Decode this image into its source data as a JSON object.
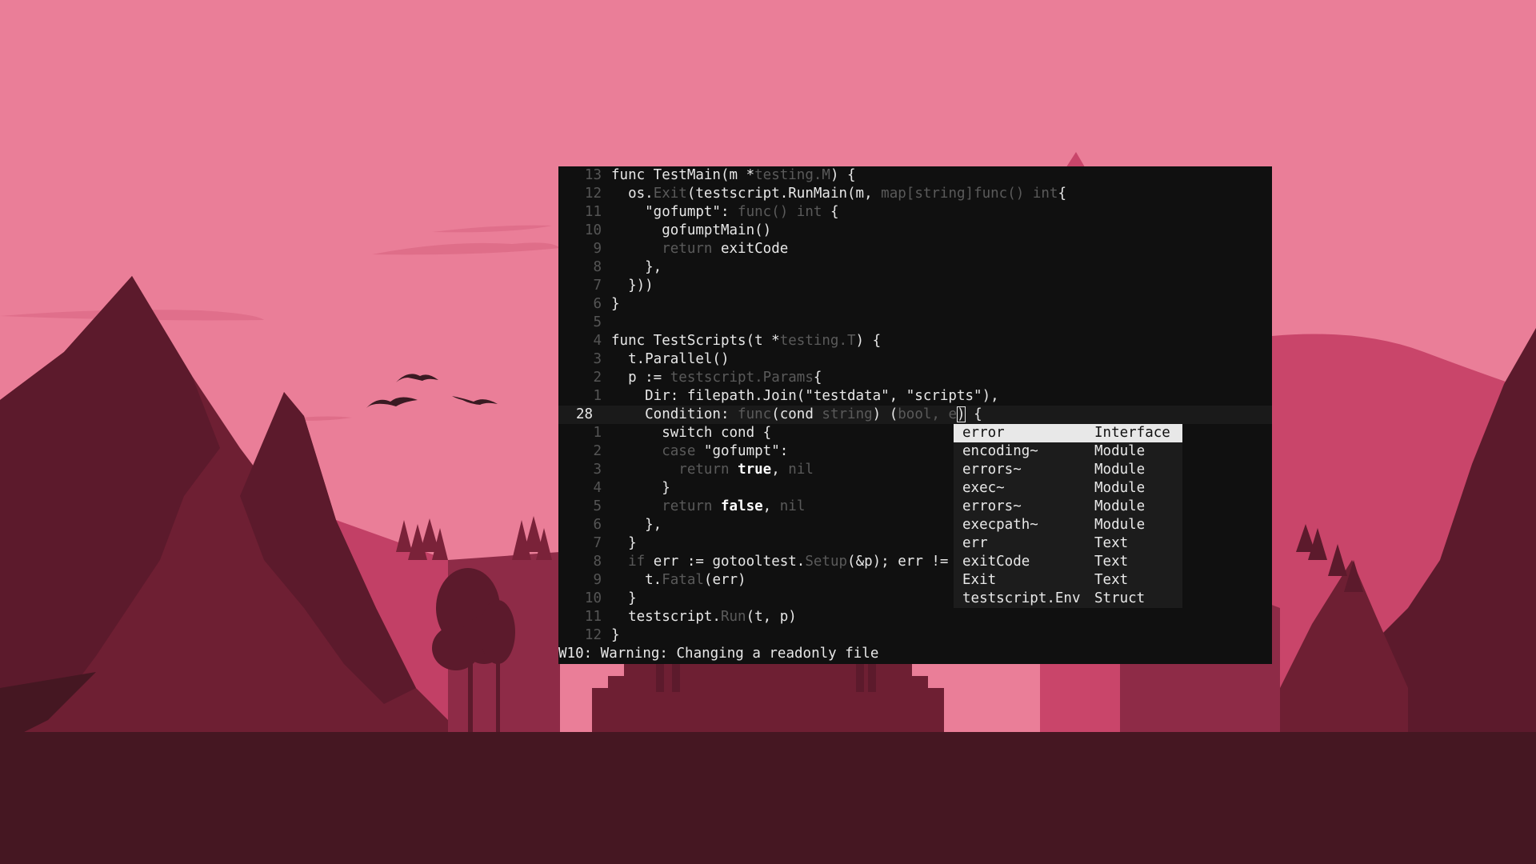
{
  "editor": {
    "lines": [
      {
        "num": "13",
        "current": false,
        "parts": [
          [
            "plain",
            "func TestMain(m *"
          ],
          [
            "dim",
            "testing.M"
          ],
          [
            "plain",
            ") {"
          ]
        ]
      },
      {
        "num": "12",
        "current": false,
        "parts": [
          [
            "plain",
            "  os."
          ],
          [
            "dim",
            "Exit"
          ],
          [
            "plain",
            "(testscript.RunMain(m, "
          ],
          [
            "dim",
            "map[string]func() int"
          ],
          [
            "plain",
            "{"
          ]
        ]
      },
      {
        "num": "11",
        "current": false,
        "parts": [
          [
            "plain",
            "    \"gofumpt\": "
          ],
          [
            "dim",
            "func() int"
          ],
          [
            "plain",
            " {"
          ]
        ]
      },
      {
        "num": "10",
        "current": false,
        "parts": [
          [
            "plain",
            "      gofumptMain()"
          ]
        ]
      },
      {
        "num": "9",
        "current": false,
        "parts": [
          [
            "plain",
            "      "
          ],
          [
            "dim",
            "return"
          ],
          [
            "plain",
            " exitCode"
          ]
        ]
      },
      {
        "num": "8",
        "current": false,
        "parts": [
          [
            "plain",
            "    },"
          ]
        ]
      },
      {
        "num": "7",
        "current": false,
        "parts": [
          [
            "plain",
            "  }))"
          ]
        ]
      },
      {
        "num": "6",
        "current": false,
        "parts": [
          [
            "plain",
            "}"
          ]
        ]
      },
      {
        "num": "5",
        "current": false,
        "parts": []
      },
      {
        "num": "4",
        "current": false,
        "parts": [
          [
            "plain",
            "func TestScripts(t *"
          ],
          [
            "dim",
            "testing.T"
          ],
          [
            "plain",
            ") {"
          ]
        ]
      },
      {
        "num": "3",
        "current": false,
        "parts": [
          [
            "plain",
            "  t.Parallel()"
          ]
        ]
      },
      {
        "num": "2",
        "current": false,
        "parts": [
          [
            "plain",
            "  p := "
          ],
          [
            "dim",
            "testscript.Params"
          ],
          [
            "plain",
            "{"
          ]
        ]
      },
      {
        "num": "1",
        "current": false,
        "parts": [
          [
            "plain",
            "    Dir: filepath.Join(\"testdata\", \"scripts\"),"
          ]
        ]
      },
      {
        "num": "28",
        "current": true,
        "parts": [
          [
            "plain",
            "    Condition: "
          ],
          [
            "dim",
            "func"
          ],
          [
            "plain",
            "(cond "
          ],
          [
            "dim",
            "string"
          ],
          [
            "plain",
            ") ("
          ],
          [
            "dim",
            "bool, e"
          ],
          [
            "cursor",
            ")"
          ],
          [
            "plain",
            " {"
          ]
        ]
      },
      {
        "num": "1",
        "current": false,
        "parts": [
          [
            "plain",
            "      switch cond {"
          ]
        ]
      },
      {
        "num": "2",
        "current": false,
        "parts": [
          [
            "plain",
            "      "
          ],
          [
            "dim",
            "case"
          ],
          [
            "plain",
            " \"gofumpt\":"
          ]
        ]
      },
      {
        "num": "3",
        "current": false,
        "parts": [
          [
            "plain",
            "        "
          ],
          [
            "dim",
            "return"
          ],
          [
            "plain",
            " "
          ],
          [
            "bold",
            "true"
          ],
          [
            "plain",
            ", "
          ],
          [
            "dim",
            "nil"
          ]
        ]
      },
      {
        "num": "4",
        "current": false,
        "parts": [
          [
            "plain",
            "      }"
          ]
        ]
      },
      {
        "num": "5",
        "current": false,
        "parts": [
          [
            "plain",
            "      "
          ],
          [
            "dim",
            "return"
          ],
          [
            "plain",
            " "
          ],
          [
            "bold",
            "false"
          ],
          [
            "plain",
            ", "
          ],
          [
            "dim",
            "nil"
          ]
        ]
      },
      {
        "num": "6",
        "current": false,
        "parts": [
          [
            "plain",
            "    },"
          ]
        ]
      },
      {
        "num": "7",
        "current": false,
        "parts": [
          [
            "plain",
            "  }"
          ]
        ]
      },
      {
        "num": "8",
        "current": false,
        "parts": [
          [
            "plain",
            "  "
          ],
          [
            "dim",
            "if"
          ],
          [
            "plain",
            " err := gotooltest."
          ],
          [
            "dim",
            "Setup"
          ],
          [
            "plain",
            "(&p); err != nil {"
          ]
        ]
      },
      {
        "num": "9",
        "current": false,
        "parts": [
          [
            "plain",
            "    t."
          ],
          [
            "dim",
            "Fatal"
          ],
          [
            "plain",
            "(err)"
          ]
        ]
      },
      {
        "num": "10",
        "current": false,
        "parts": [
          [
            "plain",
            "  }"
          ]
        ]
      },
      {
        "num": "11",
        "current": false,
        "parts": [
          [
            "plain",
            "  testscript."
          ],
          [
            "dim",
            "Run"
          ],
          [
            "plain",
            "(t, p)"
          ]
        ]
      },
      {
        "num": "12",
        "current": false,
        "parts": [
          [
            "plain",
            "}"
          ]
        ]
      }
    ],
    "status_message": "W10: Warning: Changing a readonly file"
  },
  "completion_menu": {
    "items": [
      {
        "word": "error",
        "kind": "Interface",
        "selected": true
      },
      {
        "word": "encoding~",
        "kind": "Module",
        "selected": false
      },
      {
        "word": "errors~",
        "kind": "Module",
        "selected": false
      },
      {
        "word": "exec~",
        "kind": "Module",
        "selected": false
      },
      {
        "word": "errors~",
        "kind": "Module",
        "selected": false
      },
      {
        "word": "execpath~",
        "kind": "Module",
        "selected": false
      },
      {
        "word": "err",
        "kind": "Text",
        "selected": false
      },
      {
        "word": "exitCode",
        "kind": "Text",
        "selected": false
      },
      {
        "word": "Exit",
        "kind": "Text",
        "selected": false
      },
      {
        "word": "testscript.Env",
        "kind": "Struct",
        "selected": false
      }
    ]
  },
  "colors": {
    "sky": "#ea7e98",
    "terminal_bg": "#101010",
    "text": "#e8e8e8",
    "dim_text": "#5a5a5a"
  }
}
